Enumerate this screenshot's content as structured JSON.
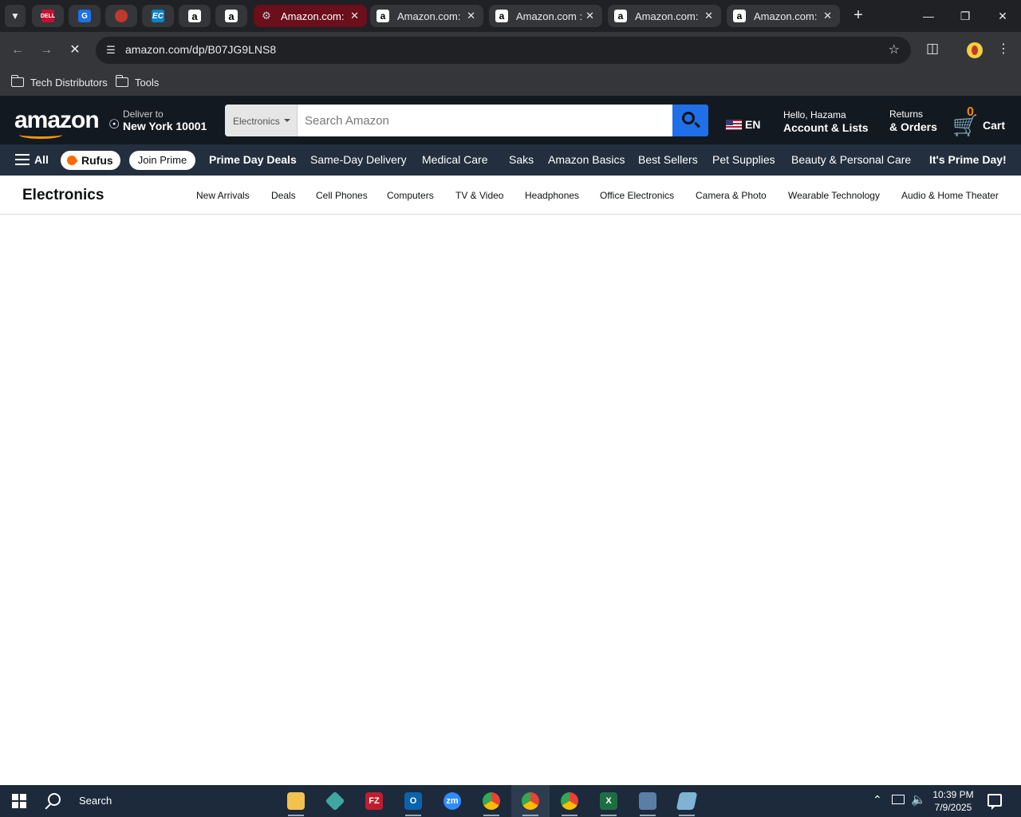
{
  "browser": {
    "pinned_tabs": [
      {
        "name": "pinned-tab-dell",
        "icon": "dell-icon",
        "label": "DELL",
        "color": "#c8102e"
      },
      {
        "name": "pinned-tab-g",
        "icon": "g-app-icon",
        "label": "G",
        "color": "#1a73e8"
      },
      {
        "name": "pinned-tab-box",
        "icon": "box-app-icon",
        "label": "",
        "color": "#c0392b"
      },
      {
        "name": "pinned-tab-ec",
        "icon": "ec-app-icon",
        "label": "EC",
        "color": "#0b84c6"
      },
      {
        "name": "pinned-tab-amazon-1",
        "icon": "amazon-icon",
        "label": "a",
        "color": "#ffffff"
      },
      {
        "name": "pinned-tab-amazon-2",
        "icon": "amazon-icon",
        "label": "a",
        "color": "#ffffff"
      }
    ],
    "tabs": [
      {
        "title": "Amazon.com: A",
        "active": true
      },
      {
        "title": "Amazon.com: A",
        "active": false
      },
      {
        "title": "Amazon.com : ",
        "active": false
      },
      {
        "title": "Amazon.com: A",
        "active": false
      },
      {
        "title": "Amazon.com: A",
        "active": false
      }
    ],
    "url": "amazon.com/dp/B07JG9LNS8",
    "bookmarks": [
      "Tech Distributors",
      "Tools"
    ]
  },
  "amazon": {
    "logo": "amazon",
    "deliver_line1": "Deliver to",
    "deliver_line2": "New York 10001",
    "search_category": "Electronics",
    "search_placeholder": "Search Amazon",
    "language": "EN",
    "account_line1": "Hello, Hazama",
    "account_line2": "Account & Lists",
    "returns_line1": "Returns",
    "returns_line2": "& Orders",
    "cart_count": "0",
    "cart_label": "Cart",
    "nav": {
      "all": "All",
      "rufus": "Rufus",
      "join_prime": "Join Prime",
      "links": [
        "Prime Day Deals",
        "Same-Day Delivery",
        "Medical Care",
        "Saks",
        "Amazon Basics",
        "Best Sellers",
        "Pet Supplies",
        "Beauty & Personal Care"
      ],
      "promo": "It's Prime Day!"
    },
    "subnav": {
      "title": "Electronics",
      "links": [
        "New Arrivals",
        "Deals",
        "Cell Phones",
        "Computers",
        "TV & Video",
        "Headphones",
        "Office Electronics",
        "Camera & Photo",
        "Wearable Technology",
        "Audio & Home Theater"
      ]
    }
  },
  "taskbar": {
    "search_label": "Search",
    "apps": [
      {
        "name": "file-explorer",
        "icon": "folder-icon",
        "label": "",
        "color": "#f2c14e"
      },
      {
        "name": "app-diamond",
        "icon": "diamond-icon",
        "label": "",
        "color": "#3fa7a0"
      },
      {
        "name": "filezilla",
        "icon": "filezilla-icon",
        "label": "FZ",
        "color": "#bf1e2e"
      },
      {
        "name": "outlook",
        "icon": "outlook-icon",
        "label": "O",
        "color": "#0a64ad"
      },
      {
        "name": "zoom",
        "icon": "zoom-icon",
        "label": "zm",
        "color": "#2d8cff"
      },
      {
        "name": "chrome-1",
        "icon": "chrome-icon",
        "label": "",
        "color": "#34a853"
      },
      {
        "name": "chrome-2",
        "icon": "chrome-icon",
        "label": "",
        "color": "#ea4335"
      },
      {
        "name": "chrome-3",
        "icon": "chrome-icon",
        "label": "",
        "color": "#fbbc05"
      },
      {
        "name": "excel",
        "icon": "excel-icon",
        "label": "X",
        "color": "#1d6f42"
      },
      {
        "name": "calculator",
        "icon": "calculator-icon",
        "label": "",
        "color": "#5b7ea6"
      },
      {
        "name": "notes",
        "icon": "notes-icon",
        "label": "",
        "color": "#7fb3d5"
      }
    ],
    "time": "10:39 PM",
    "date": "7/9/2025"
  }
}
